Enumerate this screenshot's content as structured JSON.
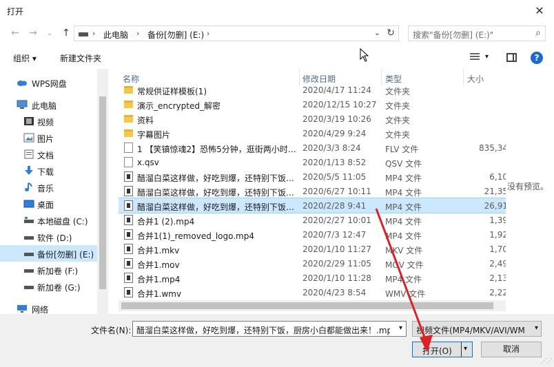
{
  "window": {
    "title": "打开",
    "close_glyph": "✕"
  },
  "nav": {
    "back": "←",
    "forward": "→",
    "recent": "⌄",
    "up": "↑",
    "breadcrumb": [
      "此电脑",
      "备份[勿删] (E:)"
    ],
    "breadcrumb_sep": "›",
    "refresh": "↻",
    "dropdown": "⌄",
    "search_placeholder": "搜索\"备份[勿删] (E:)\"",
    "search_icon": "⌕"
  },
  "toolbar": {
    "organize": "组织 ▾",
    "new_folder": "新建文件夹",
    "view_dd": "▾",
    "help": "?"
  },
  "sidebar": {
    "items": [
      {
        "label": "WPS网盘",
        "icon": "cloud-icon"
      },
      {
        "label": "此电脑",
        "icon": "computer-icon"
      },
      {
        "label": "视频",
        "icon": "video-folder-icon"
      },
      {
        "label": "图片",
        "icon": "pictures-folder-icon"
      },
      {
        "label": "文档",
        "icon": "documents-folder-icon"
      },
      {
        "label": "下载",
        "icon": "download-icon"
      },
      {
        "label": "音乐",
        "icon": "music-icon"
      },
      {
        "label": "桌面",
        "icon": "desktop-icon"
      },
      {
        "label": "本地磁盘 (C:)",
        "icon": "drive-icon"
      },
      {
        "label": "软件 (D:)",
        "icon": "drive-icon"
      },
      {
        "label": "备份[勿删] (E:)",
        "icon": "drive-icon",
        "selected": true
      },
      {
        "label": "新加卷 (F:)",
        "icon": "drive-icon"
      },
      {
        "label": "新加卷 (G:)",
        "icon": "drive-icon"
      },
      {
        "label": "网络",
        "icon": "network-icon"
      }
    ]
  },
  "columns": {
    "name": "名称",
    "date": "修改日期",
    "type": "类型",
    "size": "大小"
  },
  "files": [
    {
      "name": "常规供证样模板(1)",
      "date": "2020/4/17 11:24",
      "type": "文件夹",
      "size": "",
      "kind": "folder"
    },
    {
      "name": "演示_encrypted_解密",
      "date": "2020/12/15 10:27",
      "type": "文件夹",
      "size": "",
      "kind": "folder"
    },
    {
      "name": "资料",
      "date": "2020/3/19 10:26",
      "type": "文件夹",
      "size": "",
      "kind": "folder"
    },
    {
      "name": "字幕图片",
      "date": "2020/4/29 9:24",
      "type": "文件夹",
      "size": "",
      "kind": "folder"
    },
    {
      "name": "1 【笑镇惊魂2】恐怖5分钟，逛街两小时…",
      "date": "2020/3/3 8:24",
      "type": "FLV 文件",
      "size": "835,34",
      "kind": "doc"
    },
    {
      "name": "x.qsv",
      "date": "2020/1/13 8:52",
      "type": "QSV 文件",
      "size": "",
      "kind": "doc"
    },
    {
      "name": "醋溜白菜这样做，好吃到爆，还特别下饭…",
      "date": "2020/5/5 11:05",
      "type": "MP4 文件",
      "size": "6,10",
      "kind": "video"
    },
    {
      "name": "醋溜白菜这样做，好吃到爆，还特别下饭…",
      "date": "2020/6/27 10:11",
      "type": "MP4 文件",
      "size": "21,35",
      "kind": "video"
    },
    {
      "name": "醋溜白菜这样做，好吃到爆，还特别下饭…",
      "date": "2020/2/28 9:41",
      "type": "MP4 文件",
      "size": "26,91",
      "kind": "video",
      "selected": true
    },
    {
      "name": "合并1 (2).mp4",
      "date": "2020/2/27 10:01",
      "type": "MP4 文件",
      "size": "1,39",
      "kind": "video"
    },
    {
      "name": "合并1(1)_removed_logo.mp4",
      "date": "2020/7/3 12:47",
      "type": "MP4 文件",
      "size": "1,92",
      "kind": "video"
    },
    {
      "name": "合并1.mkv",
      "date": "2020/1/10 11:27",
      "type": "MKV 文件",
      "size": "1,70",
      "kind": "video"
    },
    {
      "name": "合并1.mov",
      "date": "2020/2/29 11:05",
      "type": "MOV 文件",
      "size": "2,49",
      "kind": "video"
    },
    {
      "name": "合并1.mp4",
      "date": "2020/1/10 11:28",
      "type": "MP4 文件",
      "size": "2,13",
      "kind": "video"
    },
    {
      "name": "合并1.wmv",
      "date": "2020/4/23 8:54",
      "type": "WMV 文件",
      "size": "2,22",
      "kind": "video"
    }
  ],
  "preview_text": "没有预览。",
  "bottom": {
    "filename_label": "文件名(N):",
    "filename_value": "醋溜白菜这样做，好吃到爆，还特别下饭，厨房小白都能做出来！.mp",
    "filetype_value": "视频文件(MP4/MKV/AVI/WM",
    "open_label": "打开(O)",
    "cancel_label": "取消",
    "dd": "▾"
  },
  "colors": {
    "accent": "#0078d7",
    "selection": "#cce8ff",
    "annotation": "#e02020"
  }
}
